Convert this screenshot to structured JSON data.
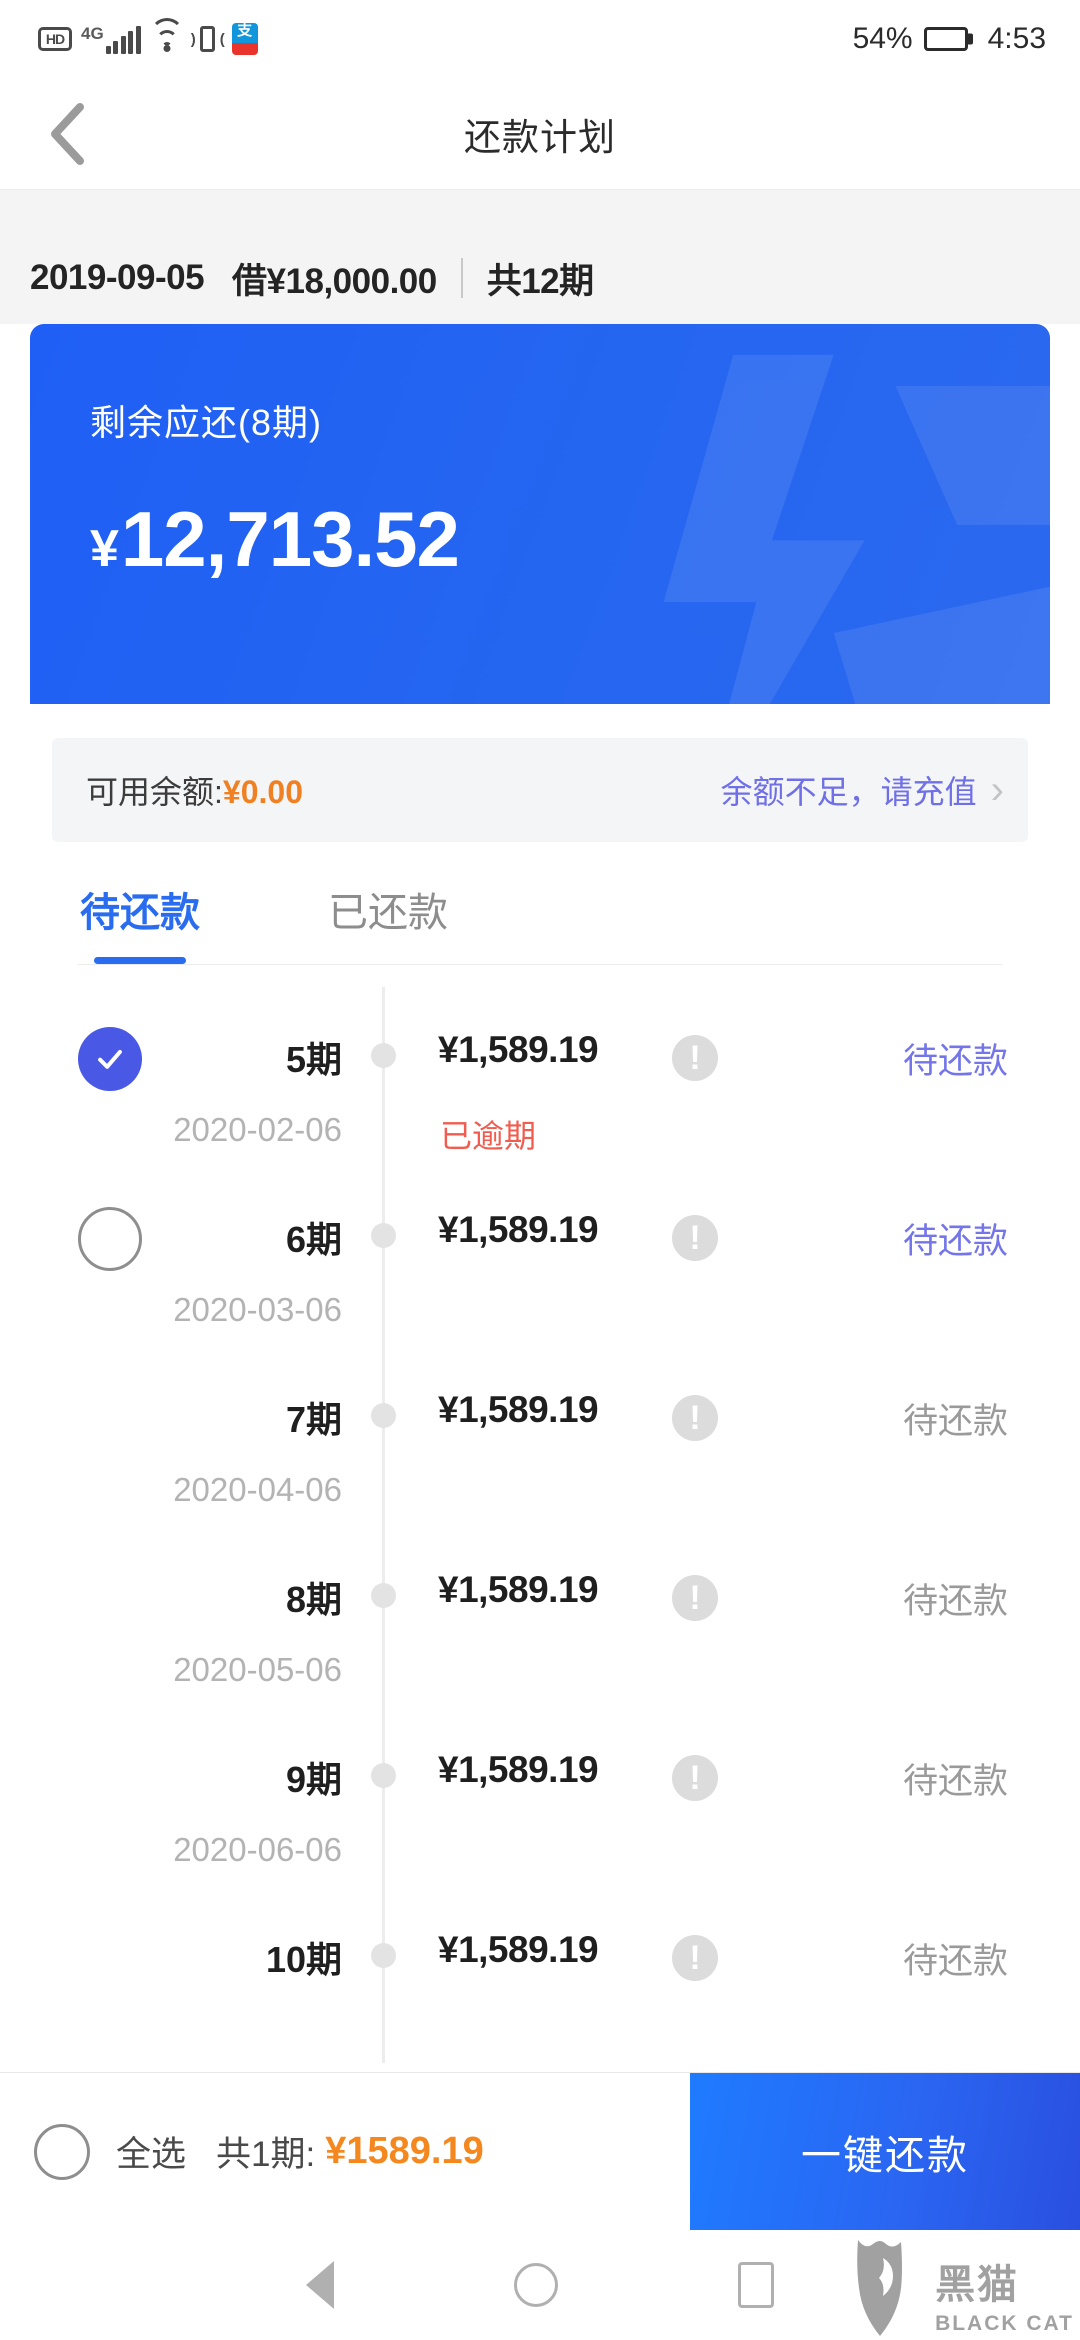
{
  "status_bar": {
    "icons": [
      "hd-icon",
      "4g-signal-icon",
      "wifi-icon",
      "vibrate-icon",
      "alipay-icon"
    ],
    "hd_label": "HD",
    "network_label": "4G",
    "alipay_label": "支",
    "battery_percent": "54%",
    "time": "4:53"
  },
  "header": {
    "back_icon": "back-chevron-icon",
    "title": "还款计划"
  },
  "loan_summary": {
    "date": "2019-09-05",
    "principal": "借¥18,000.00",
    "terms": "共12期"
  },
  "remaining_card": {
    "label": "剩余应还(8期)",
    "currency": "¥",
    "amount": "12,713.52",
    "bg_color": "#2566f0"
  },
  "balance": {
    "label": "可用余额:",
    "value": "¥0.00",
    "value_color": "#f08021",
    "link": "余额不足，请充值",
    "link_color": "#6f70e8",
    "chevron": "›"
  },
  "tabs": [
    {
      "label": "待还款",
      "active": true
    },
    {
      "label": "已还款",
      "active": false
    }
  ],
  "schedule": {
    "rows": [
      {
        "term": "5期",
        "date": "2020-02-06",
        "amount": "¥1,589.19",
        "info_icon": "!",
        "overdue": "已逾期",
        "status": "待还款",
        "status_highlight": true,
        "select_state": "checked"
      },
      {
        "term": "6期",
        "date": "2020-03-06",
        "amount": "¥1,589.19",
        "info_icon": "!",
        "overdue": "",
        "status": "待还款",
        "status_highlight": true,
        "select_state": "unchecked"
      },
      {
        "term": "7期",
        "date": "2020-04-06",
        "amount": "¥1,589.19",
        "info_icon": "!",
        "overdue": "",
        "status": "待还款",
        "status_highlight": false,
        "select_state": "none"
      },
      {
        "term": "8期",
        "date": "2020-05-06",
        "amount": "¥1,589.19",
        "info_icon": "!",
        "overdue": "",
        "status": "待还款",
        "status_highlight": false,
        "select_state": "none"
      },
      {
        "term": "9期",
        "date": "2020-06-06",
        "amount": "¥1,589.19",
        "info_icon": "!",
        "overdue": "",
        "status": "待还款",
        "status_highlight": false,
        "select_state": "none"
      },
      {
        "term": "10期",
        "date": "",
        "amount": "¥1,589.19",
        "info_icon": "!",
        "overdue": "",
        "status": "待还款",
        "status_highlight": false,
        "select_state": "none"
      }
    ]
  },
  "action_bar": {
    "select_all_label": "全选",
    "total_label": "共1期:",
    "total_amount": "¥1589.19",
    "total_color": "#f5871f",
    "pay_button": "一键还款"
  },
  "nav_bar": {
    "back_icon": "nav-back-icon",
    "home_icon": "nav-home-icon",
    "recents_icon": "nav-recents-icon"
  },
  "watermark": {
    "logo_icon": "black-cat-logo-icon",
    "cn": "黑猫",
    "en": "BLACK CAT"
  }
}
